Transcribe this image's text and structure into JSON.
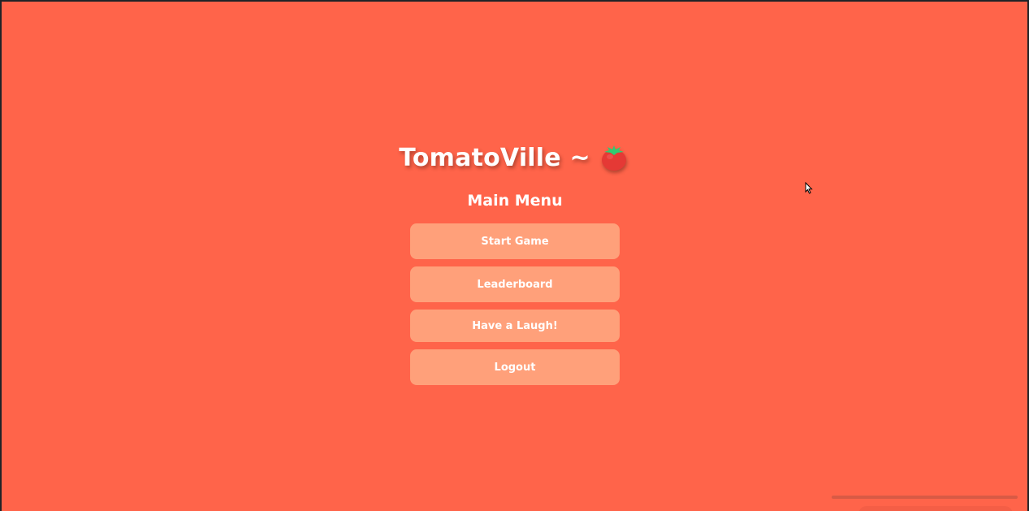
{
  "app": {
    "title": "TomatoVille ~",
    "title_icon": "tomato-icon",
    "subtitle": "Main Menu"
  },
  "menu": {
    "buttons": [
      {
        "label": "Start Game"
      },
      {
        "label": "Leaderboard"
      },
      {
        "label": "Have a Laugh!"
      },
      {
        "label": "Logout"
      }
    ]
  },
  "colors": {
    "background": "#ff644a",
    "button": "#ffa07a",
    "text": "#ffffff",
    "tomato_body": "#e53935",
    "tomato_leaf": "#2ecc71"
  }
}
